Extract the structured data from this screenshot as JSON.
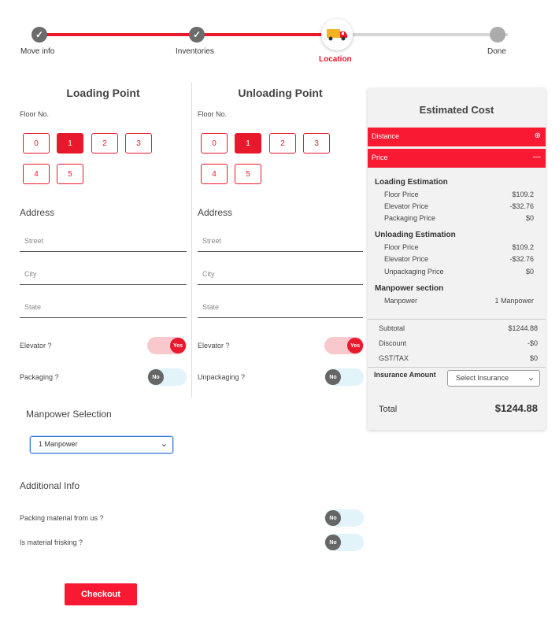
{
  "stepper": {
    "steps": [
      {
        "label": "Move info",
        "state": "done"
      },
      {
        "label": "Inventories",
        "state": "done"
      },
      {
        "label": "Location",
        "state": "active"
      },
      {
        "label": "Done",
        "state": "pending"
      }
    ]
  },
  "loading": {
    "title": "Loading Point",
    "floor_label": "Floor No.",
    "floors": [
      "0",
      "1",
      "2",
      "3",
      "4",
      "5"
    ],
    "selected_floor": "1",
    "address_label": "Address",
    "street_placeholder": "Street",
    "city_placeholder": "City",
    "state_placeholder": "State",
    "elevator_label": "Elevator ?",
    "elevator_value": "Yes",
    "packaging_label": "Packaging ?",
    "packaging_value": "No"
  },
  "unloading": {
    "title": "Unloading Point",
    "floor_label": "Floor No.",
    "floors": [
      "0",
      "1",
      "2",
      "3",
      "4",
      "5"
    ],
    "selected_floor": "1",
    "address_label": "Address",
    "street_placeholder": "Street",
    "city_placeholder": "City",
    "state_placeholder": "State",
    "elevator_label": "Elevator ?",
    "elevator_value": "Yes",
    "unpackaging_label": "Unpackaging ?",
    "unpackaging_value": "No"
  },
  "cost": {
    "title": "Estimated Cost",
    "distance_label": "Distance",
    "price_label": "Price",
    "loading_head": "Loading Estimation",
    "loading_rows": [
      {
        "label": "Floor Price",
        "value": "$109.2"
      },
      {
        "label": "Elevator Price",
        "value": "-$32.76"
      },
      {
        "label": "Packaging Price",
        "value": "$0"
      }
    ],
    "unloading_head": "Unloading Estimation",
    "unloading_rows": [
      {
        "label": "Floor Price",
        "value": "$109.2"
      },
      {
        "label": "Elevator Price",
        "value": "-$32.76"
      },
      {
        "label": "Unpackaging Price",
        "value": "$0"
      }
    ],
    "manpower_head": "Manpower section",
    "manpower_row": {
      "label": "Manpower",
      "value": "1 Manpower"
    },
    "summary": [
      {
        "label": "Subtotal",
        "value": "$1244.88"
      },
      {
        "label": "Discount",
        "value": "-$0"
      },
      {
        "label": "GST/TAX",
        "value": "$0"
      }
    ],
    "insurance_label": "Insurance Amount",
    "insurance_selected": "Select Insurance",
    "total_label": "Total",
    "total_value": "$1244.88"
  },
  "manpower": {
    "title": "Manpower Selection",
    "selected": "1 Manpower"
  },
  "additional": {
    "title": "Additional Info",
    "packing_label": "Packing material from us ?",
    "packing_value": "No",
    "frisking_label": "Is material frisking ?",
    "frisking_value": "No"
  },
  "checkout_label": "Checkout",
  "colors": {
    "accent": "#fa1932",
    "track_done": "#e8192c",
    "track_pending": "#d6d6d6"
  }
}
